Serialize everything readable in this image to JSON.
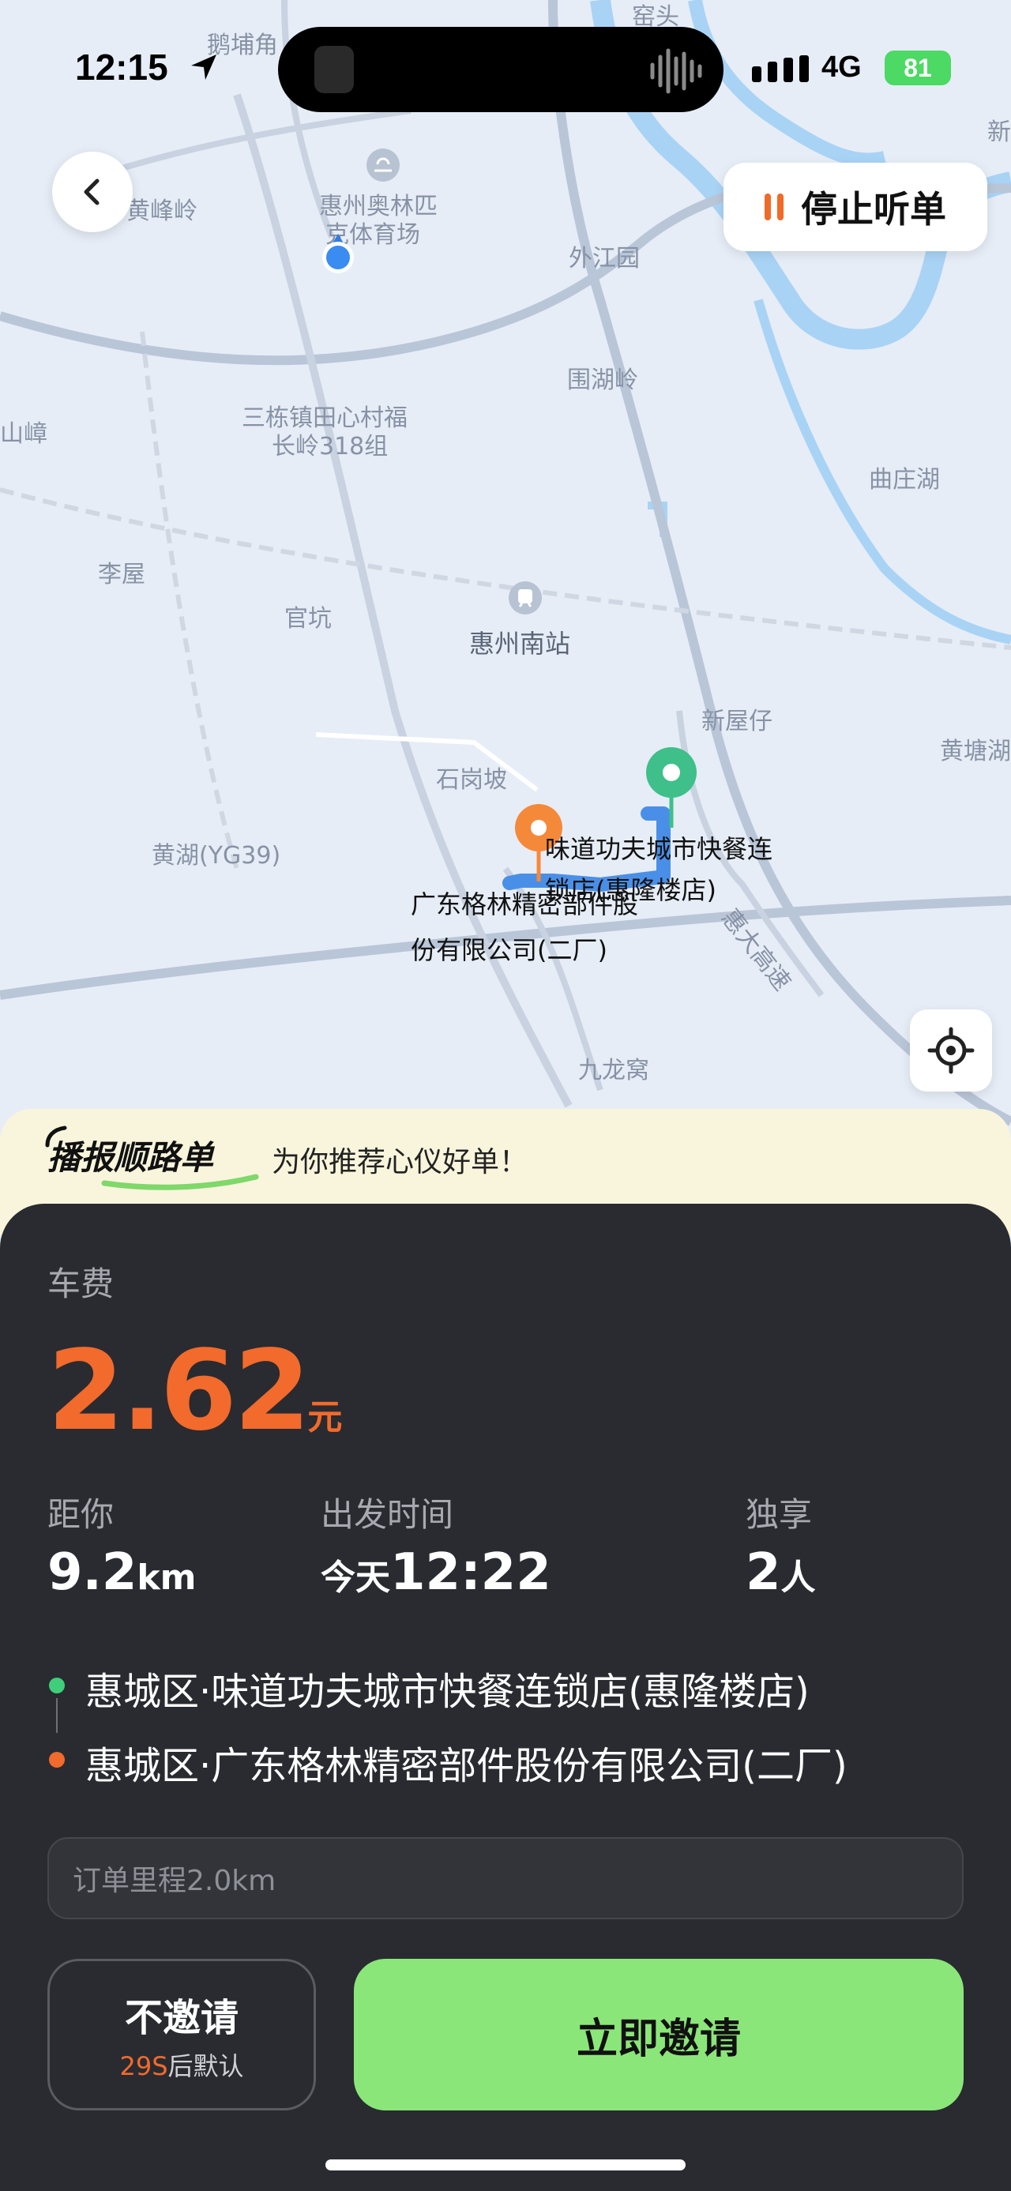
{
  "status_bar": {
    "time": "12:15",
    "network": "4G",
    "battery": "81"
  },
  "map": {
    "labels": {
      "l1": "鹅埔角",
      "l2": "窑头",
      "l3": "黄峰岭",
      "l4": "惠州奥林匹",
      "l5": "克体育场",
      "l6": "外江园",
      "l7": "新",
      "l8": "山嶂",
      "l9": "三栋镇田心村福",
      "l10": "长岭318组",
      "l11": "围湖岭",
      "l12": "曲庄湖",
      "l13": "李屋",
      "l14": "官坑",
      "l15": "惠州南站",
      "l16": "新屋仔",
      "l17": "黄塘湖",
      "l18": "石岗坡",
      "l19": "黄湖(YG39)",
      "l20": "味道功夫城市快餐连",
      "l21": "锁店(惠隆楼店)",
      "l22": "广东格林精密部件股",
      "l23": "份有限公司(二厂)",
      "l24": "惠大高速",
      "l25": "九龙窝"
    },
    "stop_listening": "停止听单",
    "colors": {
      "water": "#a9d3f5",
      "road": "#b9c6d8",
      "route": "#4a8fe7",
      "start_pin": "#3fbf8a",
      "end_pin": "#f5893a"
    }
  },
  "banner": {
    "logo": "播报顺路单",
    "text": "为你推荐心仪好单！"
  },
  "card": {
    "fare_label": "车费",
    "fare_value": "2.62",
    "fare_unit": "元",
    "distance_label": "距你",
    "distance_value": "9.2",
    "distance_unit": "km",
    "depart_label": "出发时间",
    "depart_day": "今天",
    "depart_time": "12:22",
    "share_label": "独享",
    "share_value": "2",
    "share_unit": "人",
    "from": "惠城区·味道功夫城市快餐连锁店(惠隆楼店)",
    "to": "惠城区·广东格林精密部件股份有限公司(二厂)",
    "mileage_placeholder": "订单里程2.0km",
    "decline_label": "不邀请",
    "decline_countdown": "29S",
    "decline_suffix": "后默认",
    "invite_label": "立即邀请",
    "colors": {
      "accent": "#f26a2c",
      "invite": "#8be679",
      "start_dot": "#3fcf7a",
      "end_dot": "#f26a2c"
    }
  }
}
